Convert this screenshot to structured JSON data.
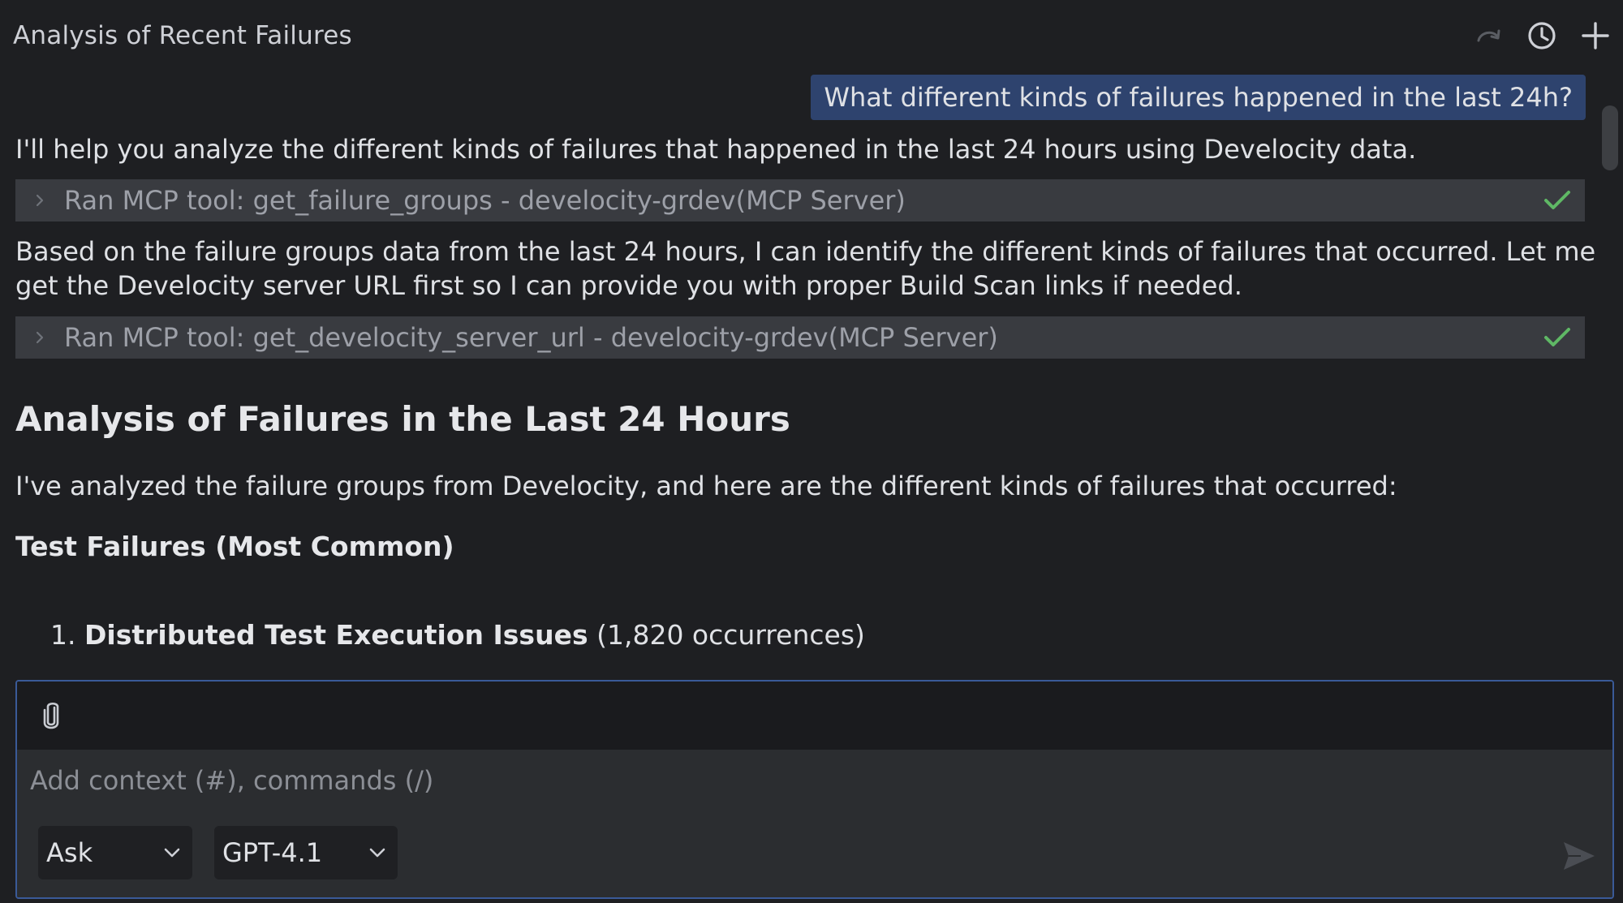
{
  "header": {
    "title": "Analysis of Recent Failures",
    "icons": [
      "redo-icon",
      "history-icon",
      "plus-icon"
    ]
  },
  "conversation": {
    "user_message": "What different kinds of failures happened in the last 24h?",
    "assistant_intro": "I'll help you analyze the different kinds of failures that happened in the last 24 hours using Develocity data.",
    "tool_calls": [
      {
        "label": "Ran MCP tool: get_failure_groups - develocity-grdev(MCP Server)",
        "status": "done"
      },
      {
        "label": "Ran MCP tool: get_develocity_server_url - develocity-grdev(MCP Server)",
        "status": "done"
      }
    ],
    "middle_paragraph_line1": "Based on the failure groups data from the last 24 hours, I can identify the different kinds of failures that occurred. Let me",
    "middle_paragraph_line2": "get the Develocity server URL first so I can provide you with proper Build Scan links if needed.",
    "heading": "Analysis of Failures in the Last 24 Hours",
    "analysis_intro": "I've analyzed the failure groups from Develocity, and here are the different kinds of failures that occurred:",
    "section_title": "Test Failures (Most Common)",
    "list": [
      {
        "number": "1.",
        "title": "Distributed Test Execution Issues",
        "detail": "(1,820 occurrences)"
      }
    ]
  },
  "composer": {
    "placeholder": "Add context (#), commands (/)",
    "value": "",
    "mode": "Ask",
    "model": "GPT-4.1"
  },
  "colors": {
    "background": "#1e1f22",
    "user_bubble": "#2e436e",
    "tool_row": "#393b40",
    "check": "#5fb865",
    "focus_border": "#3a5a98"
  }
}
